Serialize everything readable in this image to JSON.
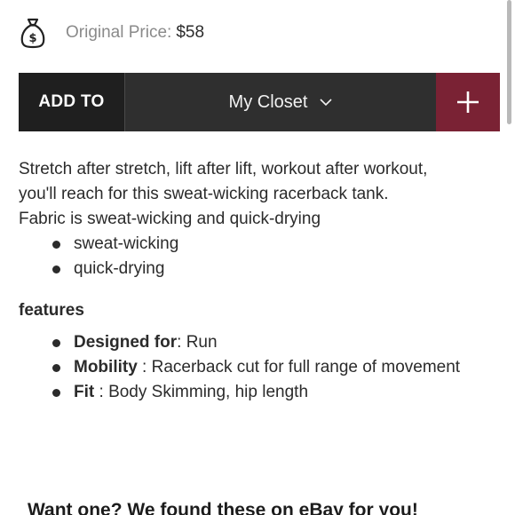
{
  "price": {
    "icon": "moneybag-icon",
    "label": "Original Price:",
    "value": "$58"
  },
  "closet_bar": {
    "add_to_label": "ADD TO",
    "selected_closet": "My Closet",
    "chevron_icon": "chevron-down-icon",
    "add_icon": "plus-icon",
    "accent_color": "#7a2234"
  },
  "description": {
    "line1": "Stretch after stretch, lift after lift, workout after workout,",
    "line2": "you'll reach for this sweat-wicking racerback tank.",
    "line3": "Fabric is sweat-wicking and quick-drying",
    "bullets": [
      "sweat-wicking",
      "quick-drying"
    ]
  },
  "features": {
    "heading": "features",
    "items": [
      {
        "name": "Designed for",
        "sep": ": ",
        "value": "Run"
      },
      {
        "name": "Mobility",
        "sep": " : ",
        "value": "Racerback cut for full range of movement"
      },
      {
        "name": "Fit",
        "sep": " : ",
        "value": "Body Skimming, hip length"
      }
    ]
  },
  "ebay": {
    "heading": "Want one? We found these on eBay for you!"
  }
}
